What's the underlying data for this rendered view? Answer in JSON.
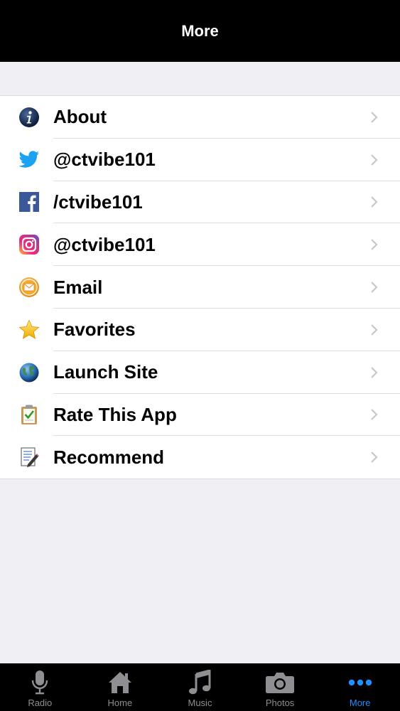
{
  "navbar": {
    "title": "More"
  },
  "menu": {
    "items": [
      {
        "label": "About",
        "icon": "info-icon"
      },
      {
        "label": "@ctvibe101",
        "icon": "twitter-icon"
      },
      {
        "label": "/ctvibe101",
        "icon": "facebook-icon"
      },
      {
        "label": "@ctvibe101",
        "icon": "instagram-icon"
      },
      {
        "label": "Email",
        "icon": "email-icon"
      },
      {
        "label": "Favorites",
        "icon": "star-icon"
      },
      {
        "label": "Launch Site",
        "icon": "globe-icon"
      },
      {
        "label": "Rate This App",
        "icon": "clipboard-check-icon"
      },
      {
        "label": "Recommend",
        "icon": "notepad-icon"
      }
    ]
  },
  "tabbar": {
    "tabs": [
      {
        "label": "Radio",
        "icon": "microphone-icon"
      },
      {
        "label": "Home",
        "icon": "home-icon"
      },
      {
        "label": "Music",
        "icon": "music-note-icon"
      },
      {
        "label": "Photos",
        "icon": "camera-icon"
      },
      {
        "label": "More",
        "icon": "more-dots-icon",
        "active": true
      }
    ],
    "active_color": "#1e90ff",
    "inactive_color": "#8e8e93"
  }
}
